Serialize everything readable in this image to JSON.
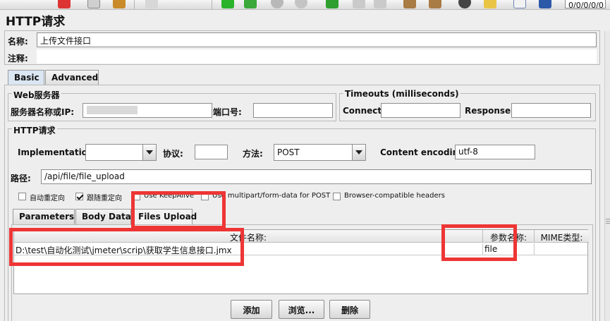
{
  "window": {
    "title": "HTTP请求"
  },
  "name_field": {
    "label": "名称:",
    "value": "上传文件接口"
  },
  "comment_field": {
    "label": "注释:",
    "value": ""
  },
  "main_tabs": [
    {
      "label": "Basic"
    },
    {
      "label": "Advanced"
    }
  ],
  "web_server": {
    "group_title": "Web服务器",
    "server_label": "服务器名称或IP:",
    "server_value": "",
    "port_label": "端口号:",
    "port_value": ""
  },
  "timeouts": {
    "group_title": "Timeouts (milliseconds)",
    "connect_label": "Connect:",
    "connect_value": "",
    "response_label": "Response:",
    "response_value": ""
  },
  "http_request": {
    "group_title": "HTTP请求",
    "implementation_label": "Implementation:",
    "implementation_value": "",
    "protocol_label": "协议:",
    "protocol_value": "",
    "method_label": "方法:",
    "method_value": "POST",
    "encoding_label": "Content encoding:",
    "encoding_value": "utf-8",
    "path_label": "路径:",
    "path_value": "/api/file/file_upload"
  },
  "checkboxes": [
    {
      "label": "自动重定向",
      "checked": false
    },
    {
      "label": "跟随重定向",
      "checked": true
    },
    {
      "label": "Use KeepAlive",
      "checked": false
    },
    {
      "label": "Use multipart/form-data for POST",
      "checked": false
    },
    {
      "label": "Browser-compatible headers",
      "checked": false
    }
  ],
  "sub_tabs": [
    {
      "label": "Parameters"
    },
    {
      "label": "Body Data"
    },
    {
      "label": "Files Upload"
    }
  ],
  "files_table": {
    "headers": [
      "文件名称:",
      "参数名称:",
      "MIME类型:"
    ],
    "rows": [
      {
        "file": "D:\\test\\自动化测试\\jmeter\\scrip\\获取学生信息接口.jmx",
        "param": "file",
        "mime": ""
      }
    ]
  },
  "buttons": {
    "add": "添加",
    "browse": "浏览...",
    "delete": "删除"
  },
  "toolbar": {
    "field_value": "0/0/0/0/0"
  },
  "colors": {
    "highlight": "#ee3535",
    "selected_tab": "#dbe6f3"
  }
}
